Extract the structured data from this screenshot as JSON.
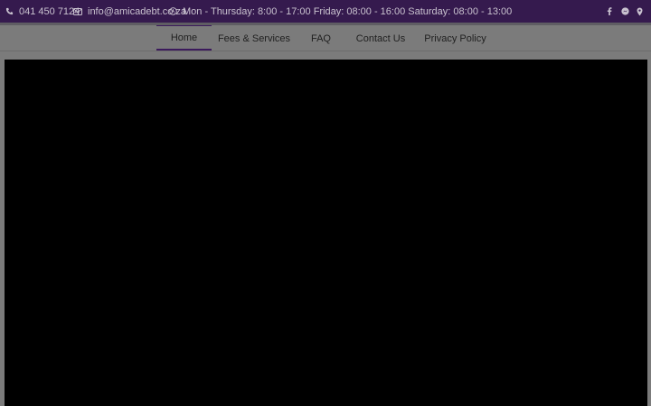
{
  "topbar": {
    "phone": "041 450 7124",
    "email": "info@amicadebt.co.za",
    "hours": "Mon - Thursday: 8:00 - 17:00 Friday: 08:00 - 16:00 Saturday: 08:00 - 13:00",
    "icons": {
      "phone": "phone-icon",
      "email": "envelope-icon",
      "hours": "clock-icon"
    },
    "social": [
      "facebook-icon",
      "messenger-icon",
      "map-pin-icon"
    ]
  },
  "nav": {
    "items": [
      {
        "label": "Home",
        "active": true
      },
      {
        "label": "Fees & Services",
        "active": false
      },
      {
        "label": "FAQ",
        "active": false
      },
      {
        "label": "Contact Us",
        "active": false
      },
      {
        "label": "Privacy Policy",
        "active": false
      }
    ]
  },
  "colors": {
    "topbar_bg": "#351a4e",
    "page_overlay": "#7b7b7b",
    "accent": "#3b1a5c",
    "hero_bg": "#000000"
  }
}
